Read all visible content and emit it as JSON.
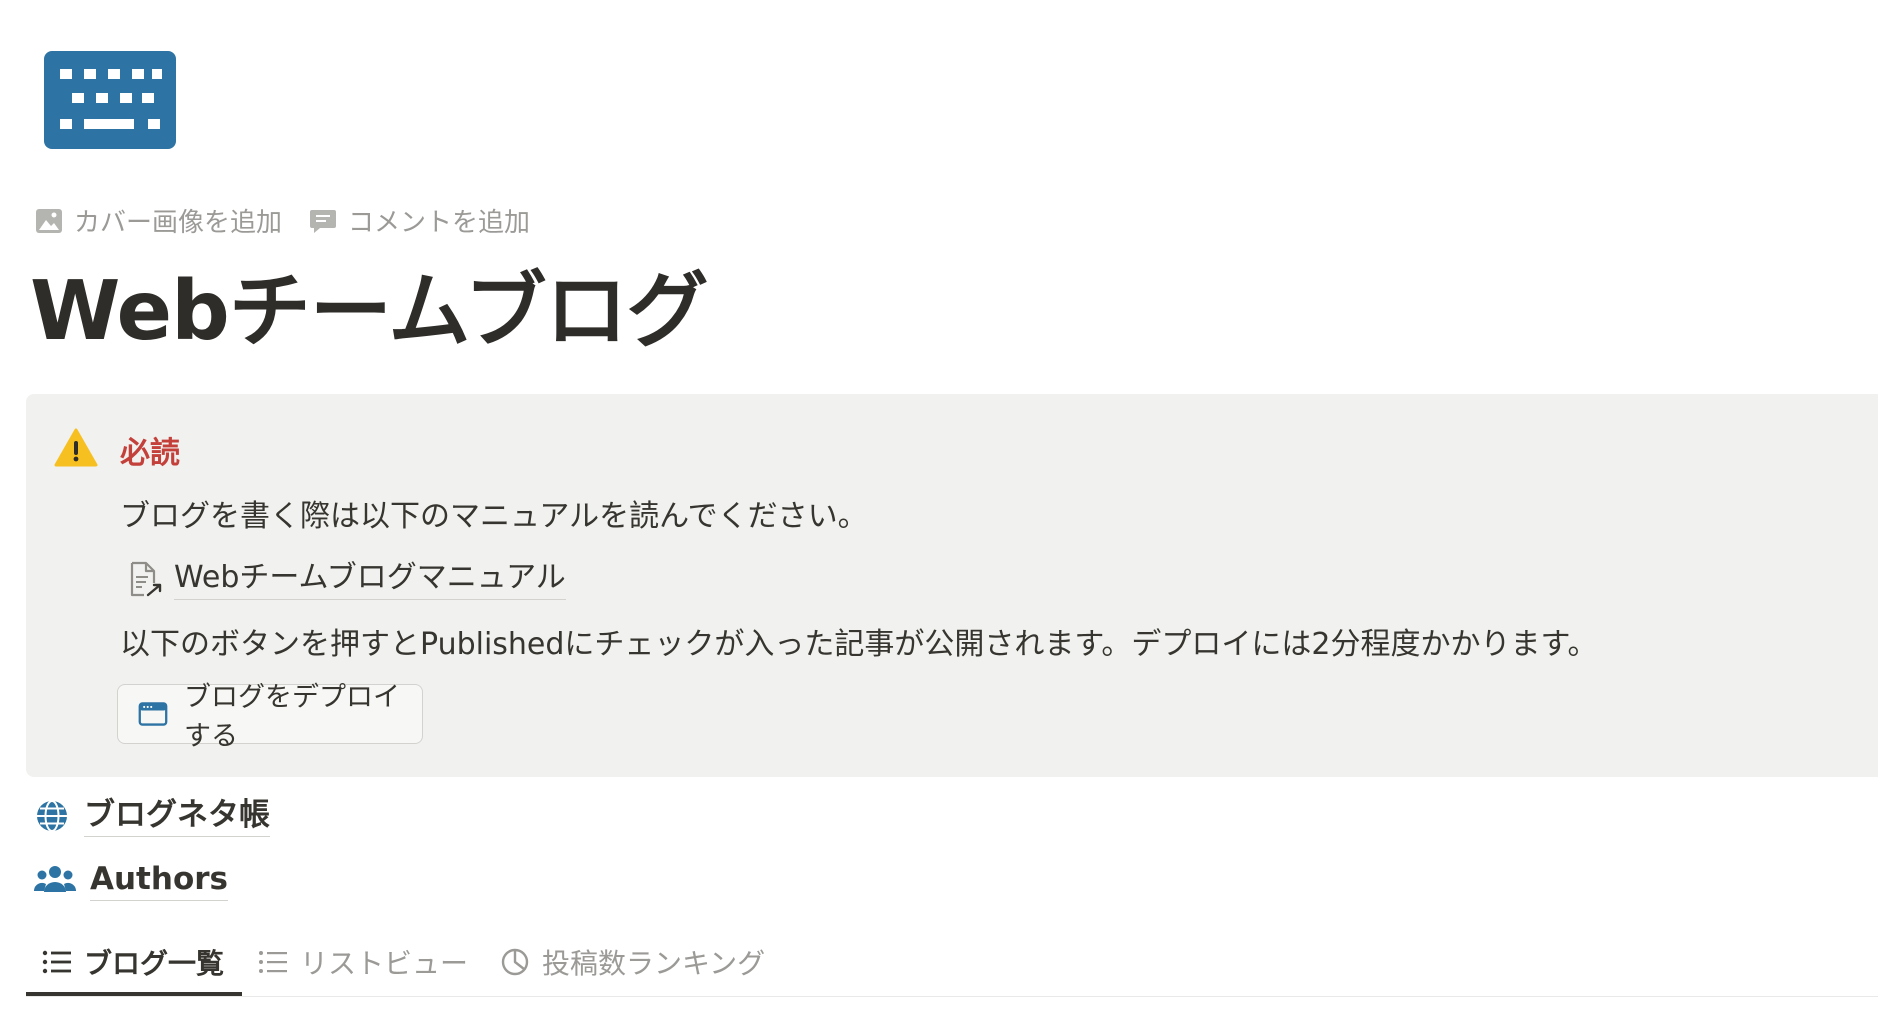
{
  "page": {
    "icon_name": "keyboard-icon",
    "icon_color": "#2d73a3",
    "title": "Webチームブログ"
  },
  "actions": {
    "add_cover": "カバー画像を追加",
    "add_comment": "コメントを追加"
  },
  "callout": {
    "icon_name": "warning-icon",
    "heading": "必読",
    "heading_color": "#c4403a",
    "text1": "ブログを書く際は以下のマニュアルを読んでください。",
    "manual_link": "Webチームブログマニュアル",
    "text2": "以下のボタンを押すとPublishedにチェックが入った記事が公開されます。デプロイには2分程度かかります。",
    "deploy_button": "ブログをデプロイする"
  },
  "links": [
    {
      "icon_name": "globe-icon",
      "label": "ブログネタ帳"
    },
    {
      "icon_name": "people-icon",
      "label": "Authors"
    }
  ],
  "tabs": [
    {
      "icon_name": "list-icon",
      "label": "ブログ一覧",
      "active": true
    },
    {
      "icon_name": "list-icon",
      "label": "リストビュー",
      "active": false
    },
    {
      "icon_name": "pie-chart-icon",
      "label": "投稿数ランキング",
      "active": false
    }
  ]
}
